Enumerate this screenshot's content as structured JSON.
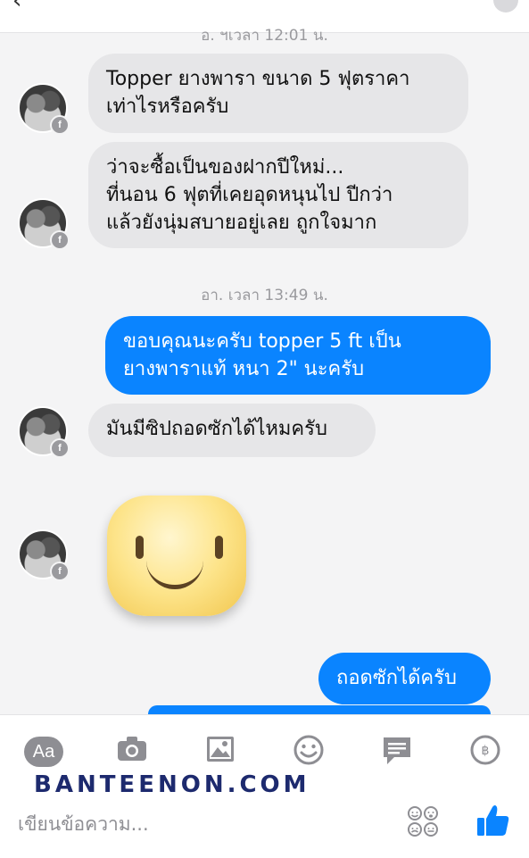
{
  "header": {
    "back_glyph": "‹"
  },
  "thread": {
    "timestamp_top": "อ. ฯเวลา 12:01 น.",
    "timestamp_mid": "อา. เวลา 13:49 น.",
    "messages": [
      {
        "side": "in",
        "text": "Topper ยางพารา ขนาด 5 ฟุตราคา\nเท่าไรหรือครับ"
      },
      {
        "side": "in",
        "text": "ว่าจะซื้อเป็นของฝากปีใหม่...\n  ที่นอน 6 ฟุตที่เคยอุดหนุนไป ปีกว่า\nแล้วยังนุ่มสบายอยู่เลย ถูกใจมาก"
      },
      {
        "side": "out",
        "text": "ขอบคุณนะครับ topper 5 ft เป็น\nยางพาราแท้ หนา 2\" นะครับ"
      },
      {
        "side": "in",
        "text": "มันมีซิปถอดซักได้ไหมครับ"
      },
      {
        "side": "in",
        "type": "sticker",
        "sticker": "smiley-face"
      },
      {
        "side": "out",
        "text": "ถอดซักได้ครับ"
      }
    ],
    "avatar_badge": "f"
  },
  "composer": {
    "aa_label": "Aa",
    "icons": [
      "camera-icon",
      "image-icon",
      "smiley-icon",
      "chat-bubble-icon",
      "payment-icon"
    ],
    "watermark": "BANTEENON.COM",
    "placeholder": "เขียนข้อความ...",
    "payment_symbol": "฿"
  },
  "colors": {
    "outgoing": "#0a84ff",
    "incoming": "#e6e6e8",
    "icon": "#8e8e93"
  }
}
